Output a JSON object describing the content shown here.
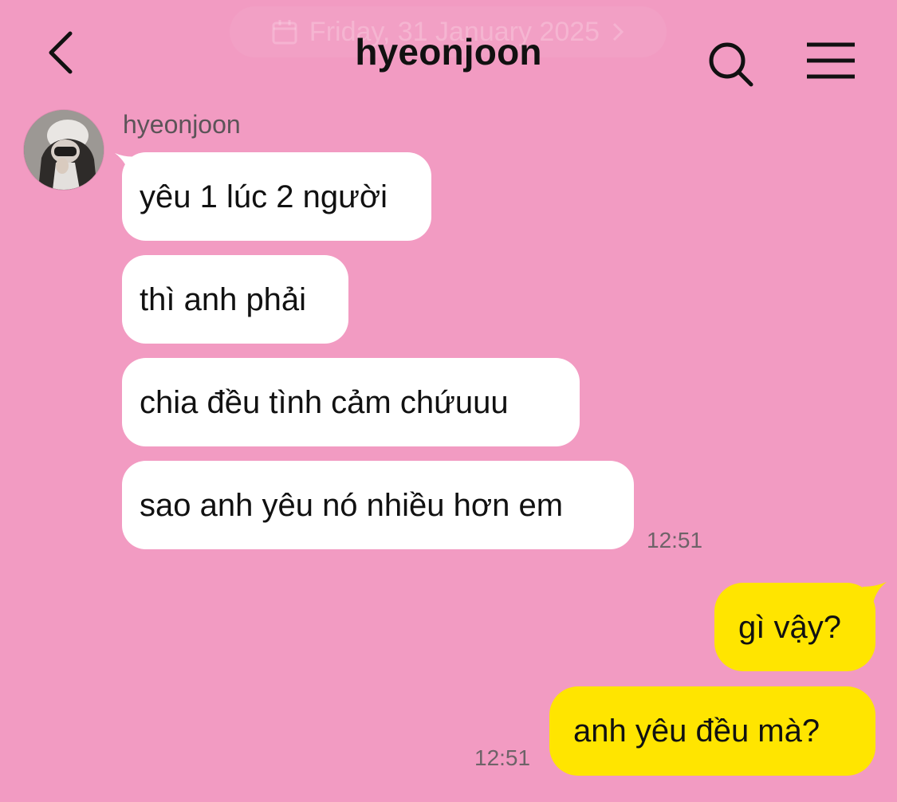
{
  "header": {
    "date": "Friday, 31 January 2025",
    "title": "hyeonjoon"
  },
  "icons": {
    "back": "chevron-left-icon",
    "search": "search-icon",
    "menu": "hamburger-menu-icon",
    "calendar": "calendar-icon",
    "date_chevron": "chevron-right-icon"
  },
  "colors": {
    "background": "#f29bc2",
    "incoming_bubble": "#ffffff",
    "outgoing_bubble": "#ffe500"
  },
  "conversation": {
    "sender_name": "hyeonjoon",
    "incoming": [
      {
        "text": "yêu 1 lúc 2 người"
      },
      {
        "text": "thì anh phải"
      },
      {
        "text": "chia đều tình cảm chứuuu"
      },
      {
        "text": "sao anh yêu nó nhiều hơn em"
      }
    ],
    "incoming_time": "12:51",
    "outgoing": [
      {
        "text": "gì vậy?"
      },
      {
        "text": "anh yêu đều mà?"
      }
    ],
    "outgoing_time": "12:51"
  }
}
